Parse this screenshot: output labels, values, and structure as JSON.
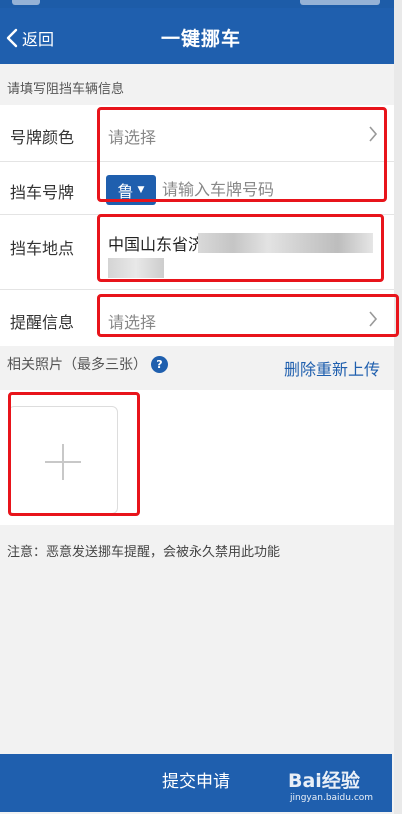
{
  "nav": {
    "back_label": "返回",
    "title": "一键挪车"
  },
  "section_hint": "请填写阻挡车辆信息",
  "form": {
    "plate_color": {
      "label": "号牌颜色",
      "value": "请选择"
    },
    "plate_number": {
      "label": "挡车号牌",
      "province": "鲁",
      "placeholder": "请输入车牌号码"
    },
    "location": {
      "label": "挡车地点",
      "value": "中国山东省济"
    },
    "reminder": {
      "label": "提醒信息",
      "value": "请选择"
    }
  },
  "photos": {
    "header": "相关照片（最多三张）",
    "reupload": "删除重新上传"
  },
  "notice": "注意：恶意发送挪车提醒，会被永久禁用此功能",
  "submit_label": "提交申请",
  "watermark": {
    "logo": "Bai经验",
    "url": "jingyan.baidu.com"
  },
  "colors": {
    "primary": "#1f5fae",
    "highlight": "#e8141b",
    "background": "#f2f2f2"
  }
}
